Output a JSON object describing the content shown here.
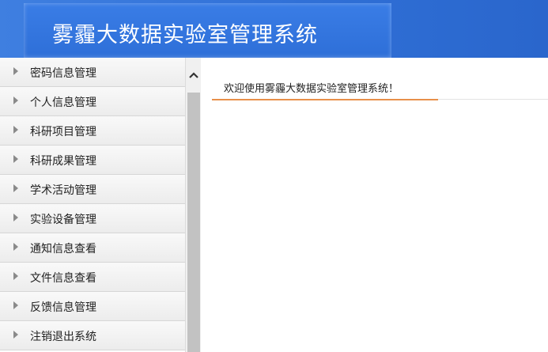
{
  "header": {
    "title": "雾霾大数据实验室管理系统"
  },
  "sidebar": {
    "items": [
      {
        "label": "密码信息管理"
      },
      {
        "label": "个人信息管理"
      },
      {
        "label": "科研项目管理"
      },
      {
        "label": "科研成果管理"
      },
      {
        "label": "学术活动管理"
      },
      {
        "label": "实验设备管理"
      },
      {
        "label": "通知信息查看"
      },
      {
        "label": "文件信息查看"
      },
      {
        "label": "反馈信息管理"
      },
      {
        "label": "注销退出系统"
      }
    ]
  },
  "main": {
    "welcome": "欢迎使用雾霾大数据实验室管理系统！"
  },
  "colors": {
    "header_blue": "#2f6fd6",
    "accent_orange": "#e8904a"
  }
}
